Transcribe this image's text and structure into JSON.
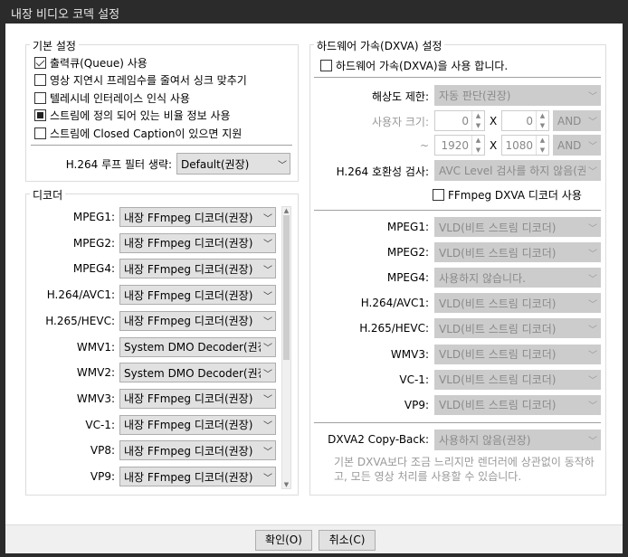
{
  "title": "내장 비디오 코덱 설정",
  "basic": {
    "title": "기본 설정",
    "options": [
      {
        "label": "출력큐(Queue) 사용",
        "state": "checked"
      },
      {
        "label": "영상 지연시 프레임수를 줄여서 싱크 맞추기",
        "state": "unchecked"
      },
      {
        "label": "텔레시네 인터레이스 인식 사용",
        "state": "unchecked"
      },
      {
        "label": "스트림에 정의 되어 있는 비율 정보 사용",
        "state": "indeterminate"
      },
      {
        "label": "스트림에 Closed Caption이 있으면 지원",
        "state": "unchecked"
      }
    ],
    "loop_filter_label": "H.264 루프 필터 생략:",
    "loop_filter_value": "Default(권장)"
  },
  "decoder": {
    "title": "디코더",
    "rows": [
      {
        "label": "MPEG1:",
        "value": "내장 FFmpeg 디코더(권장)"
      },
      {
        "label": "MPEG2:",
        "value": "내장 FFmpeg 디코더(권장)"
      },
      {
        "label": "MPEG4:",
        "value": "내장 FFmpeg 디코더(권장)"
      },
      {
        "label": "H.264/AVC1:",
        "value": "내장 FFmpeg 디코더(권장)"
      },
      {
        "label": "H.265/HEVC:",
        "value": "내장 FFmpeg 디코더(권장)"
      },
      {
        "label": "WMV1:",
        "value": "System DMO Decoder(권장)"
      },
      {
        "label": "WMV2:",
        "value": "System DMO Decoder(권장)"
      },
      {
        "label": "WMV3:",
        "value": "내장 FFmpeg 디코더(권장)"
      },
      {
        "label": "VC-1:",
        "value": "내장 FFmpeg 디코더(권장)"
      },
      {
        "label": "VP8:",
        "value": "내장 FFmpeg 디코더(권장)"
      },
      {
        "label": "VP9:",
        "value": "내장 FFmpeg 디코더(권장)"
      }
    ]
  },
  "dxva": {
    "title": "하드웨어 가속(DXVA) 설정",
    "enable_label": "하드웨어 가속(DXVA)을 사용 합니다.",
    "res_label": "해상도 제한:",
    "res_value": "자동 판단(권장)",
    "user_size_label": "사용자 크기:",
    "min_w": "0",
    "min_h": "0",
    "op1": "AND",
    "tilde": "~",
    "max_w": "1920",
    "max_h": "1080",
    "op2": "AND",
    "x": "X",
    "compat_label": "H.264 호환성 검사:",
    "compat_value": "AVC Level 검사를 하지 않음(권",
    "ffmpeg_dxva_label": "FFmpeg DXVA 디코더 사용",
    "rows": [
      {
        "label": "MPEG1:",
        "value": "VLD(비트 스트림 디코더)"
      },
      {
        "label": "MPEG2:",
        "value": "VLD(비트 스트림 디코더)"
      },
      {
        "label": "MPEG4:",
        "value": "사용하지 않습니다."
      },
      {
        "label": "H.264/AVC1:",
        "value": "VLD(비트 스트림 디코더)"
      },
      {
        "label": "H.265/HEVC:",
        "value": "VLD(비트 스트림 디코더)"
      },
      {
        "label": "WMV3:",
        "value": "VLD(비트 스트림 디코더)"
      },
      {
        "label": "VC-1:",
        "value": "VLD(비트 스트림 디코더)"
      },
      {
        "label": "VP9:",
        "value": "VLD(비트 스트림 디코더)"
      }
    ],
    "copyback_label": "DXVA2 Copy-Back:",
    "copyback_value": "사용하지 않음(권장)",
    "hint": "기본 DXVA보다 조금 느리지만 렌더러에 상관없이 동작하고, 모든 영상 처리를 사용할 수 있습니다."
  },
  "buttons": {
    "ok": "확인(O)",
    "cancel": "취소(C)"
  }
}
